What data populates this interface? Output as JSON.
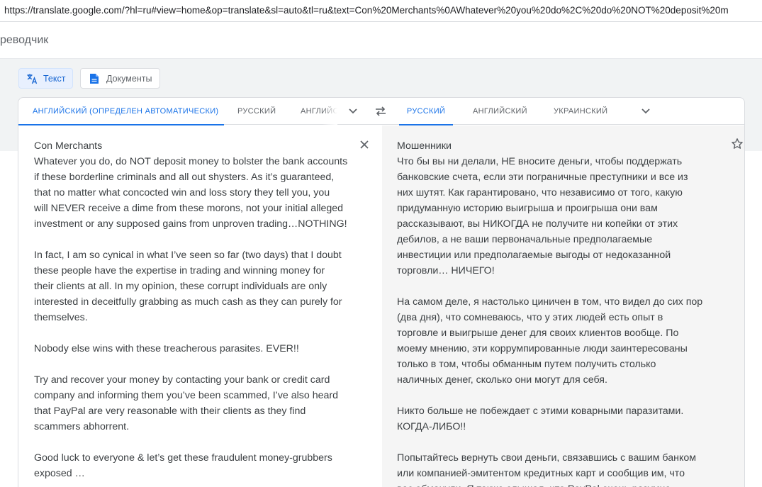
{
  "browser": {
    "url": "https://translate.google.com/?hl=ru#view=home&op=translate&sl=auto&tl=ru&text=Con%20Merchants%0AWhatever%20you%20do%2C%20do%20NOT%20deposit%20m"
  },
  "app": {
    "title": "реводчик"
  },
  "modes": {
    "text_label": "Текст",
    "documents_label": "Документы"
  },
  "source_langs": {
    "detected": "АНГЛИЙСКИЙ (ОПРЕДЕЛЕН АВТОМАТИЧЕСКИ)",
    "russian": "РУССКИЙ",
    "english_truncated": "АНГЛИЙС"
  },
  "target_langs": {
    "russian": "РУССКИЙ",
    "english": "АНГЛИЙСКИЙ",
    "ukrainian": "УКРАИНСКИЙ"
  },
  "source_text": "Con Merchants\nWhatever you do, do NOT deposit money to bolster the bank accounts\nif these borderline criminals and all out shysters. As it’s guaranteed,\nthat no matter what concocted win and loss story they tell you, you\nwill NEVER receive a dime from these morons, not your initial alleged\ninvestment or any supposed gains from unproven trading…NOTHING!\n\nIn fact, I am so cynical in what I’ve seen so far (two days) that I doubt\nthese people have the expertise in trading and winning money for\ntheir clients at all. In my opinion, these corrupt individuals are only\ninterested in deceitfully grabbing as much cash as they can purely for\nthemselves.\n\nNobody else wins with these treacherous parasites. EVER!!\n\nTry and recover your money by contacting your bank or credit card\ncompany and informing them you’ve been scammed, I’ve also heard\nthat PayPal are very reasonable with their clients as they find\nscammers abhorrent.\n\nGood luck to everyone & let’s get these fraudulent money-grubbers\nexposed …",
  "target_text": "Мошенники\nЧто бы вы ни делали, НЕ вносите деньги, чтобы поддержать\nбанковские счета, если эти пограничные преступники и все из\nних шутят. Как гарантировано, что независимо от того, какую\nпридуманную историю выигрыша и проигрыша они вам\nрассказывают, вы НИКОГДА не получите ни копейки от этих\nдебилов, а не ваши первоначальные предполагаемые\nинвестиции или предполагаемые выгоды от недоказанной\nторговли… НИЧЕГО!\n\nНа самом деле, я настолько циничен в том, что видел до сих пор\n(два дня), что сомневаюсь, что у этих людей есть опыт в\nторговле и выигрыше денег для своих клиентов вообще. По\nмоему мнению, эти коррумпированные люди заинтересованы\nтолько в том, чтобы обманным путем получить столько\nналичных денег, сколько они могут для себя.\n\nНикто больше не побеждает с этими коварными паразитами.\nКОГДА-ЛИБО!!\n\nПопытайтесь вернуть свои деньги, связавшись с вашим банком\nили компанией-эмитентом кредитных карт и сообщив им, что\nвас обманули. Я также слышал, что PayPal очень разумно",
  "icons": {
    "translate_mode": "translate-icon",
    "document_mode": "document-icon",
    "more_source": "chevron-down-icon",
    "swap": "swap-arrows-icon",
    "more_target": "chevron-down-icon",
    "clear": "close-icon",
    "save": "star-icon"
  },
  "colors": {
    "accent": "#1a73e8",
    "band": "#f1f3f4",
    "target_bg": "#f5f5f5",
    "active_mode_bg": "#e8f0fe"
  }
}
